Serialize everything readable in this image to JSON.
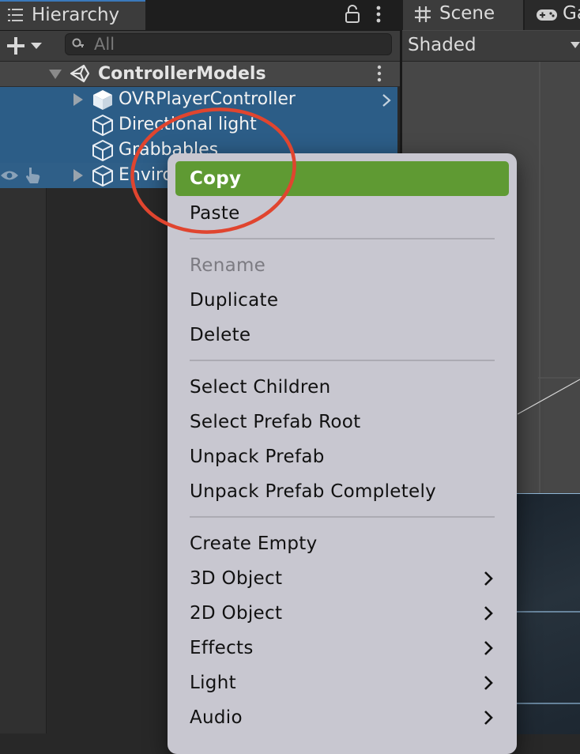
{
  "hierarchy": {
    "tab_label": "Hierarchy",
    "search_placeholder": "All",
    "scene_root": "ControllerModels",
    "items": [
      {
        "label": "OVRPlayerController"
      },
      {
        "label": "Directional light"
      },
      {
        "label": "Grabbables"
      },
      {
        "label": "Enviro"
      }
    ]
  },
  "scene_view": {
    "tab_label": "Scene",
    "game_tab_label": "Ga",
    "shading_mode": "Shaded"
  },
  "context_menu": {
    "items": [
      {
        "label": "Copy",
        "state": "highlighted"
      },
      {
        "label": "Paste"
      },
      {
        "label": "Rename",
        "state": "disabled"
      },
      {
        "label": "Duplicate"
      },
      {
        "label": "Delete"
      },
      {
        "label": "Select Children"
      },
      {
        "label": "Select Prefab Root"
      },
      {
        "label": "Unpack Prefab"
      },
      {
        "label": "Unpack Prefab Completely"
      },
      {
        "label": "Create Empty"
      },
      {
        "label": "3D Object",
        "submenu": true
      },
      {
        "label": "2D Object",
        "submenu": true
      },
      {
        "label": "Effects",
        "submenu": true
      },
      {
        "label": "Light",
        "submenu": true
      },
      {
        "label": "Audio",
        "submenu": true
      }
    ]
  },
  "colors": {
    "selection": "#2c5d87",
    "menu_highlight": "#5f9a33",
    "annotation": "#e0452f"
  }
}
